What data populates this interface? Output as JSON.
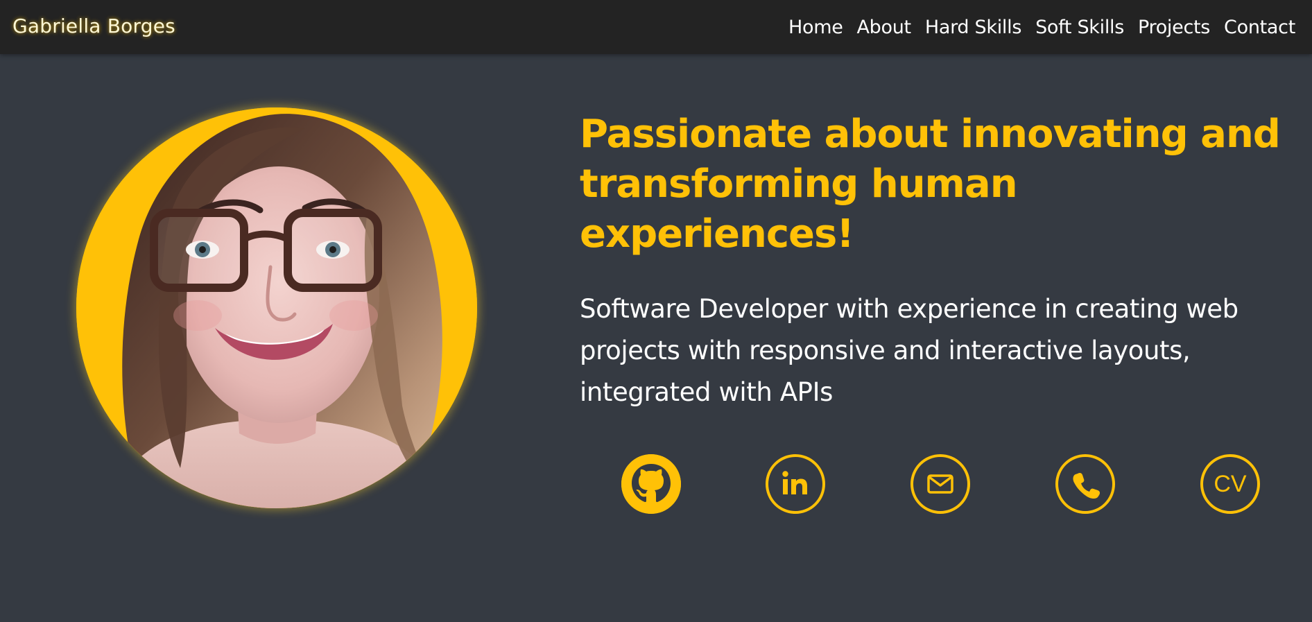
{
  "site": {
    "brand": "Gabriella Borges"
  },
  "nav": {
    "items": [
      {
        "label": "Home"
      },
      {
        "label": "About"
      },
      {
        "label": "Hard Skills"
      },
      {
        "label": "Soft Skills"
      },
      {
        "label": "Projects"
      },
      {
        "label": "Contact"
      }
    ]
  },
  "hero": {
    "headline": "Passionate about innovating and transforming human experiences!",
    "subtitle": "Software Developer with experience in creating web projects with responsive and interactive layouts, integrated with APIs",
    "photo_icon": "profile-photo"
  },
  "social": {
    "cv_label": "CV",
    "icons": [
      "github-icon",
      "linkedin-icon",
      "email-icon",
      "whatsapp-icon",
      "cv-icon"
    ]
  },
  "colors": {
    "accent": "#ffc107",
    "background": "#353a42",
    "navbar": "#232323",
    "text": "#ffffff"
  }
}
